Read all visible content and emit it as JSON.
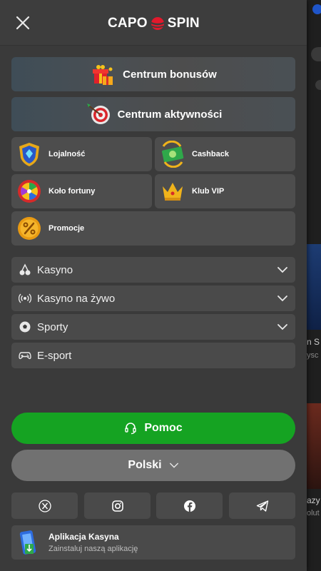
{
  "header": {
    "logo_left": "CAPO",
    "logo_right": "SPIN",
    "close_icon": "close-icon"
  },
  "feature_tiles": {
    "bonus_center": "Centrum bonusów",
    "activity_center": "Centrum aktywności"
  },
  "grid_tiles": {
    "loyalty": "Lojalność",
    "cashback": "Cashback",
    "wheel": "Koło fortuny",
    "vip": "Klub VIP",
    "promotions": "Promocje"
  },
  "nav": {
    "casino": "Kasyno",
    "live_casino": "Kasyno na żywo",
    "sports": "Sporty",
    "esport": "E-sport"
  },
  "help_button": "Pomoc",
  "language_button": "Polski",
  "social": [
    "x-icon",
    "instagram-icon",
    "facebook-icon",
    "telegram-icon"
  ],
  "app_banner": {
    "title": "Aplikacja Kasyna",
    "subtitle": "Zainstaluj naszą aplikację"
  },
  "background_page": {
    "text1": "n S",
    "text2": "ysc",
    "text3": "azy 7",
    "text4": "olut"
  },
  "colors": {
    "accent_green": "#15a322",
    "logo_red": "#e1192c",
    "menu_bg": "#3a3a3a",
    "tile_bg": "#4d4d4d"
  }
}
